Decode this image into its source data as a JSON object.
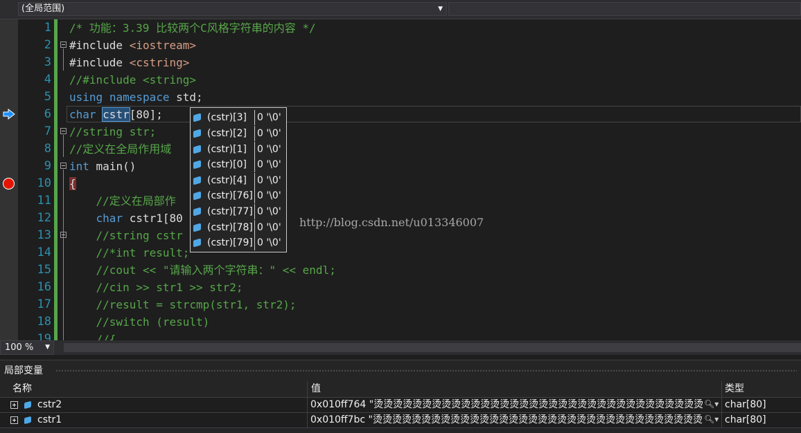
{
  "scope_bar": {
    "scope_label": "(全局范围)"
  },
  "editor": {
    "line_numbers": [
      "1",
      "2",
      "3",
      "4",
      "5",
      "6",
      "7",
      "8",
      "9",
      "10",
      "11",
      "12",
      "13",
      "14",
      "15",
      "16",
      "17",
      "18",
      "19"
    ],
    "lines": {
      "l1": "/* 功能：3.39 比较两个C风格字符串的内容 */",
      "l2_a": "#include ",
      "l2_b": "<iostream>",
      "l3_a": "#include ",
      "l3_b": "<cstring>",
      "l4": "//#include <string>",
      "l5_kw1": "using",
      "l5_kw2": "namespace",
      "l5_rest": " std;",
      "l6_kw": "char",
      "l6_word": "cstr",
      "l6_rest": "[80];",
      "l7": "//string str;",
      "l8": "//定义在全局作用域",
      "l9_kw": "int",
      "l9_rest": " main()",
      "l10": "{",
      "l11": "    //定义在局部作",
      "l12_kw": "char",
      "l12_rest": " cstr1[80",
      "l13": "    //string cstr",
      "l14": "    //*int result;",
      "l15": "    //cout << \"请输入两个字符串：\" << endl;",
      "l16": "    //cin >> str1 >> str2;",
      "l17": "    //result = strcmp(str1, str2);",
      "l18": "    //switch (result)",
      "l19": "    //{"
    },
    "watermark": "http://blog.csdn.net/u013346007"
  },
  "datatip": {
    "rows": [
      {
        "name": "(cstr)[3]",
        "value": "0 '\\0'"
      },
      {
        "name": "(cstr)[2]",
        "value": "0 '\\0'"
      },
      {
        "name": "(cstr)[1]",
        "value": "0 '\\0'"
      },
      {
        "name": "(cstr)[0]",
        "value": "0 '\\0'"
      },
      {
        "name": "(cstr)[4]",
        "value": "0 '\\0'"
      },
      {
        "name": "(cstr)[76]",
        "value": "0 '\\0'"
      },
      {
        "name": "(cstr)[77]",
        "value": "0 '\\0'"
      },
      {
        "name": "(cstr)[78]",
        "value": "0 '\\0'"
      },
      {
        "name": "(cstr)[79]",
        "value": "0 '\\0'"
      }
    ]
  },
  "zoom": {
    "level": "100 %"
  },
  "locals": {
    "title": "局部变量",
    "columns": {
      "name": "名称",
      "value": "值",
      "type": "类型"
    },
    "rows": [
      {
        "name": "cstr2",
        "value": "0x010ff764 \"烫烫烫烫烫烫烫烫烫烫烫烫烫烫烫烫烫烫烫烫烫烫烫烫烫烫烫烫烫烫烫烫烫烫烫烫烫烫烫烫",
        "type": "char[80]"
      },
      {
        "name": "cstr1",
        "value": "0x010ff7bc \"烫烫烫烫烫烫烫烫烫烫烫烫烫烫烫烫烫烫烫烫烫烫烫烫烫烫烫烫烫烫烫烫烫烫烫烫烫烫烫烫",
        "type": "char[80]"
      }
    ]
  },
  "colors": {
    "keyword": "#569cd6",
    "comment": "#57a64a",
    "include_path": "#d69d85",
    "line_number": "#2b91af",
    "breakpoint": "#e51400"
  },
  "icons": [
    "breakpoint-icon",
    "current-statement-arrow-icon",
    "variable-icon",
    "expand-icon",
    "magnifier-icon",
    "dropdown-arrow-icon"
  ]
}
